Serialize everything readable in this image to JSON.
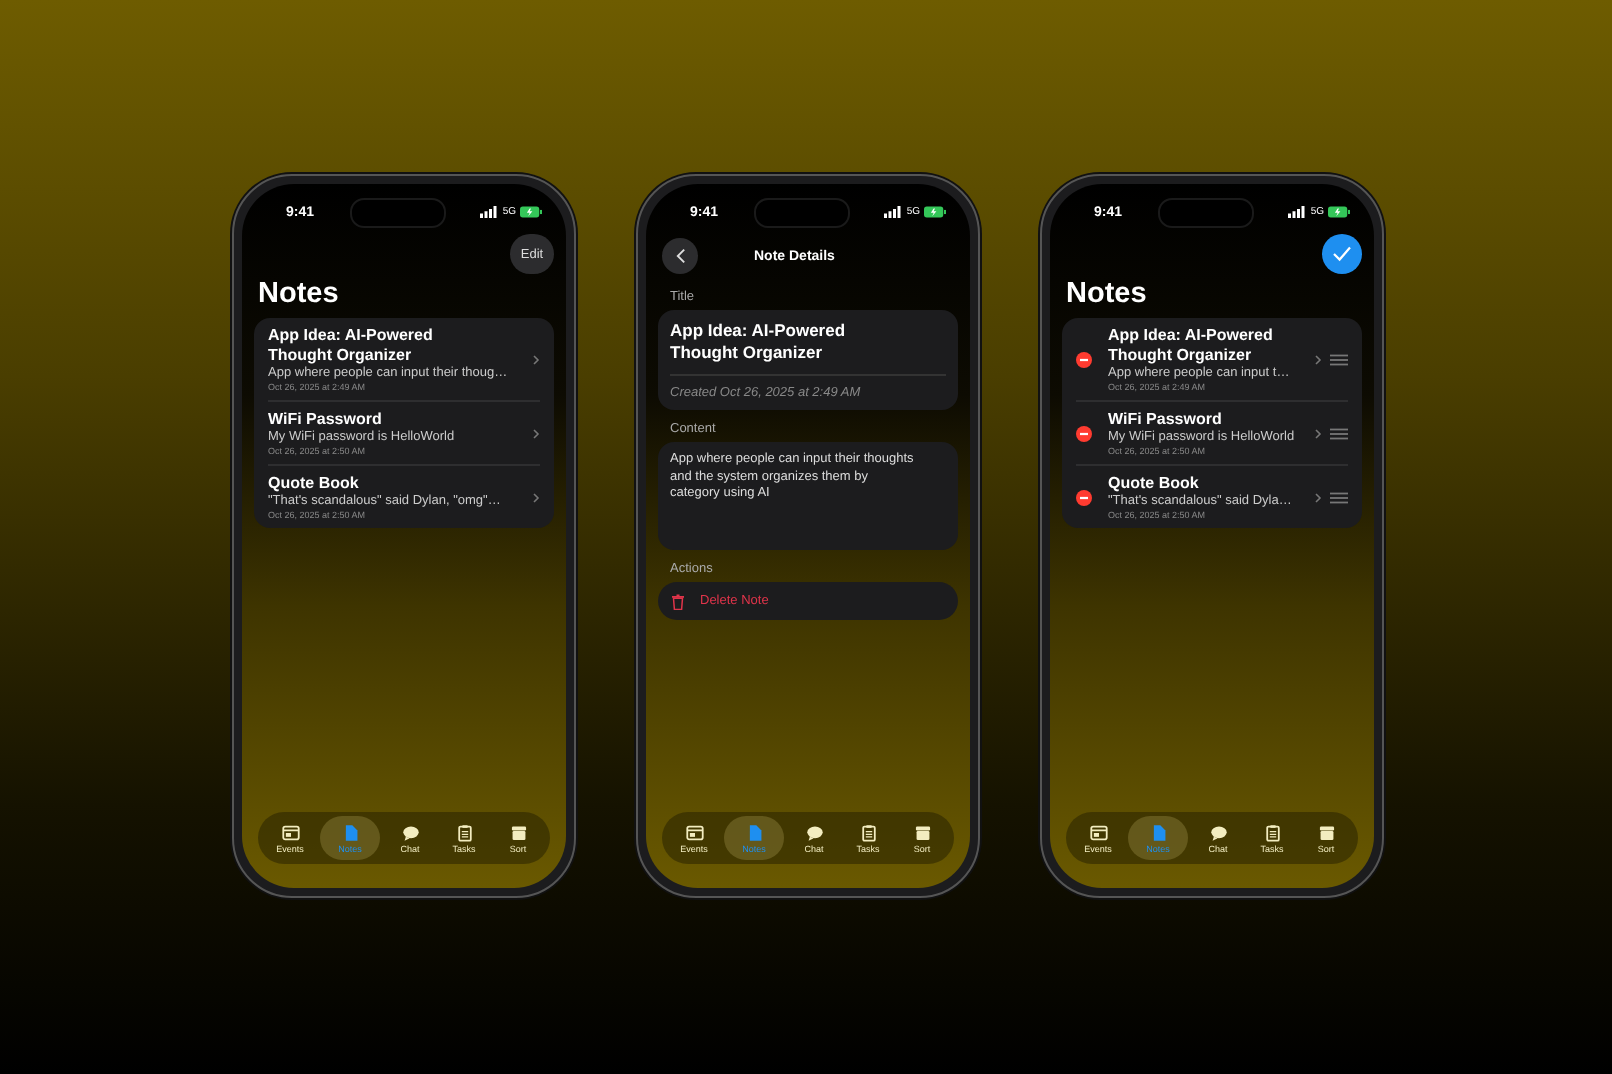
{
  "phones": [
    {
      "kind": "list",
      "status": {
        "time": "9:41",
        "network": "5G"
      },
      "header_button": {
        "kind": "text",
        "label": "Edit"
      },
      "title": "Notes",
      "editing": false,
      "notes": [
        {
          "title": "App Idea: AI-Powered Thought Organizer",
          "preview": "App where people can input their thoug…",
          "date": "Oct 26, 2025 at 2:49 AM"
        },
        {
          "title": "WiFi Password",
          "preview": "My WiFi password is HelloWorld",
          "date": "Oct 26, 2025 at 2:50 AM"
        },
        {
          "title": "Quote Book",
          "preview": "\"That's scandalous\" said Dylan, \"omg\"…",
          "date": "Oct 26, 2025 at 2:50 AM"
        }
      ],
      "tab_bar": [
        {
          "label": "Events",
          "selected": false
        },
        {
          "label": "Notes",
          "selected": true
        },
        {
          "label": "Chat",
          "selected": false
        },
        {
          "label": "Tasks",
          "selected": false
        },
        {
          "label": "Sort",
          "selected": false
        }
      ]
    },
    {
      "kind": "detail",
      "status": {
        "time": "9:41",
        "network": "5G"
      },
      "nav_title": "Note Details",
      "title_label": "Title",
      "note_title": "App Idea: AI-Powered Thought Organizer",
      "created": "Created Oct 26, 2025 at 2:49 AM",
      "content_label": "Content",
      "content": "App where people can input their thoughts and the system organizes them by category using AI",
      "actions_label": "Actions",
      "delete_label": "Delete Note",
      "tab_bar": [
        {
          "label": "Events",
          "selected": false
        },
        {
          "label": "Notes",
          "selected": true
        },
        {
          "label": "Chat",
          "selected": false
        },
        {
          "label": "Tasks",
          "selected": false
        },
        {
          "label": "Sort",
          "selected": false
        }
      ]
    },
    {
      "kind": "list",
      "status": {
        "time": "9:41",
        "network": "5G"
      },
      "header_button": {
        "kind": "done"
      },
      "title": "Notes",
      "editing": true,
      "notes": [
        {
          "title": "App Idea: AI-Powered Thought Organizer",
          "preview": "App where people can input t…",
          "date": "Oct 26, 2025 at 2:49 AM"
        },
        {
          "title": "WiFi Password",
          "preview": "My WiFi password is HelloWorld",
          "date": "Oct 26, 2025 at 2:50 AM"
        },
        {
          "title": "Quote Book",
          "preview": "\"That's scandalous\" said Dyla…",
          "date": "Oct 26, 2025 at 2:50 AM"
        }
      ],
      "tab_bar": [
        {
          "label": "Events",
          "selected": false
        },
        {
          "label": "Notes",
          "selected": true
        },
        {
          "label": "Chat",
          "selected": false
        },
        {
          "label": "Tasks",
          "selected": false
        },
        {
          "label": "Sort",
          "selected": false
        }
      ]
    }
  ]
}
